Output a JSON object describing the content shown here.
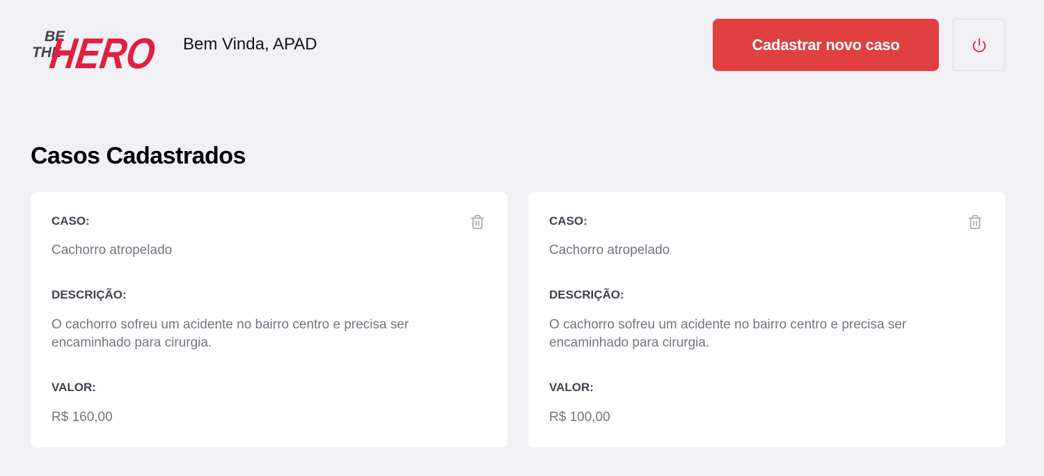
{
  "header": {
    "logo": {
      "icon": "be-the-hero-logo",
      "line1": "BE",
      "line2": "THE",
      "word": "HERO"
    },
    "greeting": "Bem Vinda, APAD",
    "new_case_label": "Cadastrar novo caso",
    "logout_icon": "power-icon"
  },
  "main": {
    "title": "Casos Cadastrados",
    "cases": [
      {
        "case_label": "CASO:",
        "case_value": "Cachorro atropelado",
        "description_label": "DESCRIÇÃO:",
        "description_value": "O cachorro sofreu um acidente no bairro centro e precisa ser encaminhado para cirurgia.",
        "value_label": "VALOR:",
        "value_value": "R$ 160,00",
        "delete_icon": "trash-icon"
      },
      {
        "case_label": "CASO:",
        "case_value": "Cachorro atropelado",
        "description_label": "DESCRIÇÃO:",
        "description_value": "O cachorro sofreu um acidente no bairro centro e precisa ser encaminhado para cirurgia.",
        "value_label": "VALOR:",
        "value_value": "R$ 100,00",
        "delete_icon": "trash-icon"
      }
    ]
  },
  "colors": {
    "background": "#f0f0f5",
    "accent": "#e04040",
    "label": "#41414d",
    "text": "#737380",
    "icon": "#a8a8b3",
    "logo_dark": "#41414d"
  }
}
